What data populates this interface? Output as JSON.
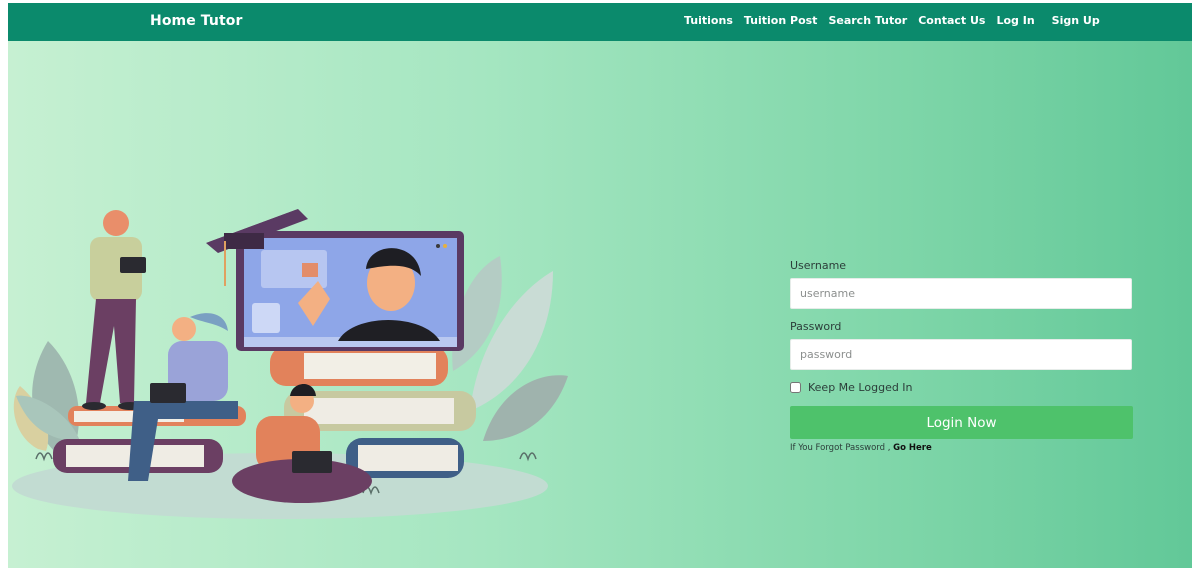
{
  "brand": "Home Tutor",
  "nav": {
    "items": [
      "Tuitions",
      "Tuition Post",
      "Search Tutor",
      "Contact Us",
      "Log In",
      "Sign Up"
    ]
  },
  "login": {
    "username_label": "Username",
    "username_placeholder": "username",
    "password_label": "Password",
    "password_placeholder": "password",
    "remember_label": "Keep Me Logged In",
    "button_label": "Login Now",
    "forgot_text": "If You Forgot Password ,",
    "forgot_link": "Go Here"
  },
  "colors": {
    "navbar": "#0b8a6c",
    "button": "#4ec26b",
    "gradient_start": "#c6f0d2",
    "gradient_end": "#62c898"
  }
}
